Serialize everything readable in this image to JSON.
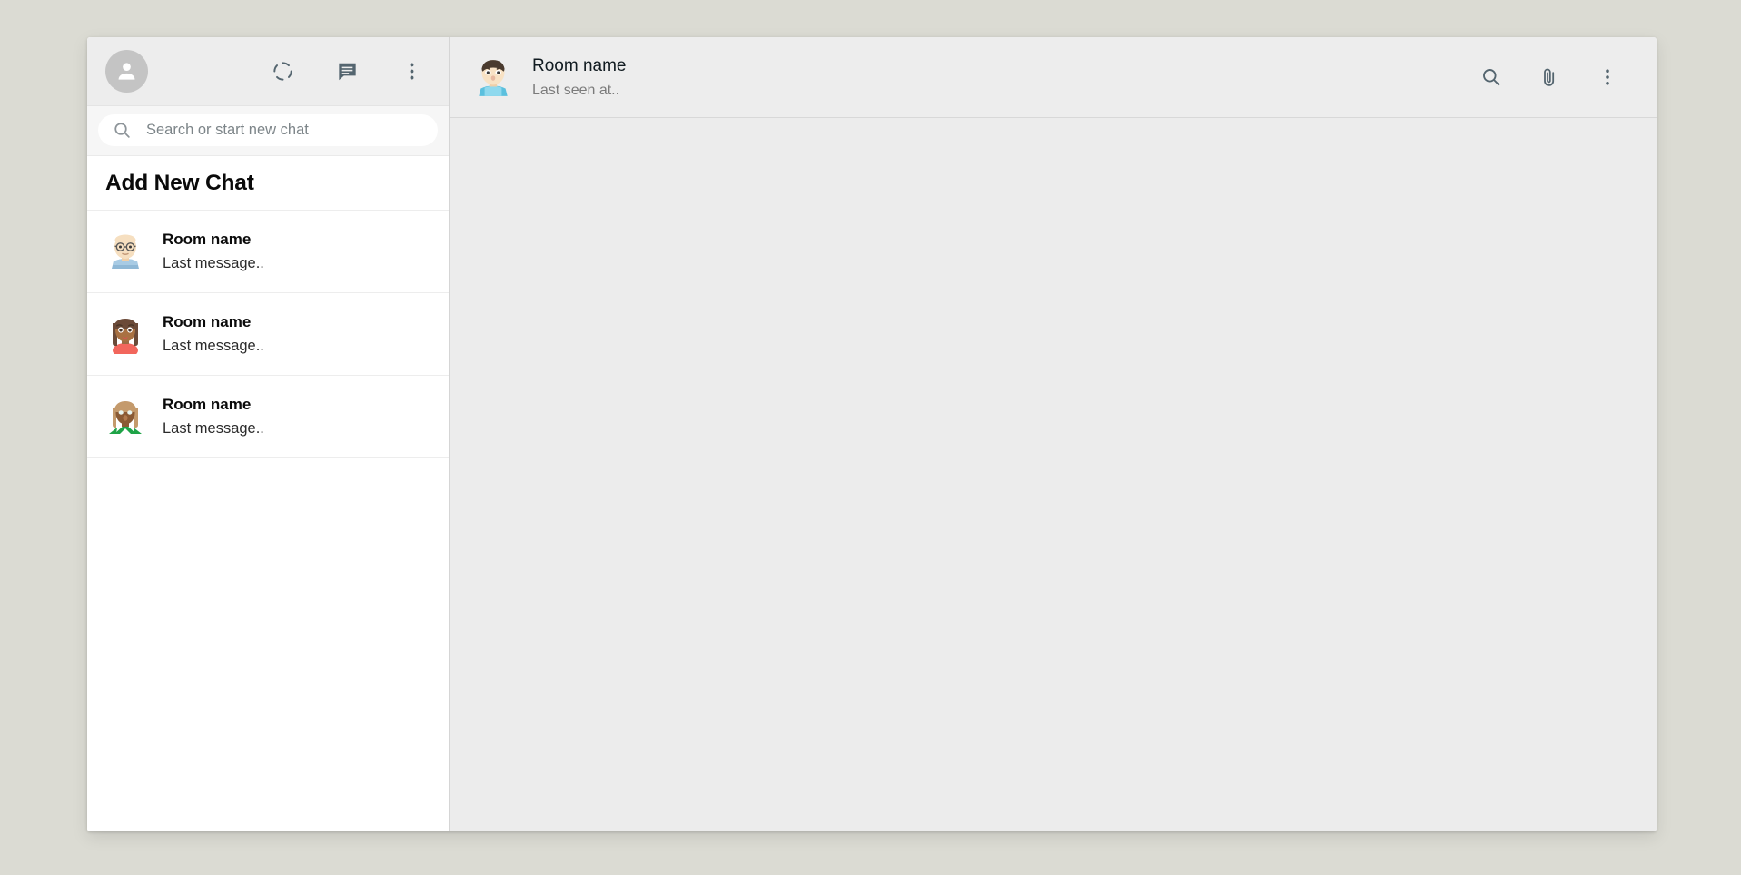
{
  "app": {
    "background_color": "#dbdbd3",
    "panel_color": "#ececec",
    "sidebar_color": "#ffffff",
    "header_color": "#ededed"
  },
  "sidebar": {
    "header": {
      "profile_avatar_icon": "person-avatar-icon",
      "actions": [
        {
          "name": "status-icon",
          "label": "Status"
        },
        {
          "name": "new-chat-icon",
          "label": "New chat"
        },
        {
          "name": "more-options-icon",
          "label": "Menu"
        }
      ]
    },
    "search": {
      "icon": "search-icon",
      "placeholder": "Search or start new chat",
      "value": ""
    },
    "add_new_chat_label": "Add New Chat",
    "chats": [
      {
        "name": "Room name",
        "last_message": "Last message..",
        "avatar": "elderly-man-with-glasses-avatar"
      },
      {
        "name": "Room name",
        "last_message": "Last message..",
        "avatar": "woman-dark-hair-red-top-avatar"
      },
      {
        "name": "Room name",
        "last_message": "Last message..",
        "avatar": "woman-blonde-hair-green-top-avatar"
      }
    ]
  },
  "chat_panel": {
    "header": {
      "avatar": "man-dark-hair-blue-shirt-avatar",
      "room_name": "Room name",
      "status": "Last seen at..",
      "actions": [
        {
          "name": "search-icon",
          "label": "Search"
        },
        {
          "name": "attach-icon",
          "label": "Attach"
        },
        {
          "name": "more-options-icon",
          "label": "Menu"
        }
      ]
    },
    "messages": []
  }
}
